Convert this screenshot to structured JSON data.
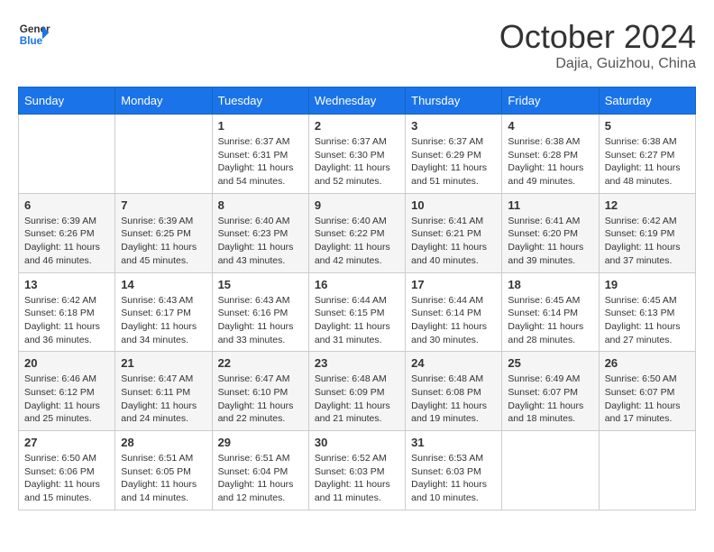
{
  "header": {
    "logo_line1": "General",
    "logo_line2": "Blue",
    "month_title": "October 2024",
    "location": "Dajia, Guizhou, China"
  },
  "weekdays": [
    "Sunday",
    "Monday",
    "Tuesday",
    "Wednesday",
    "Thursday",
    "Friday",
    "Saturday"
  ],
  "weeks": [
    [
      {
        "day": "",
        "sunrise": "",
        "sunset": "",
        "daylight": ""
      },
      {
        "day": "",
        "sunrise": "",
        "sunset": "",
        "daylight": ""
      },
      {
        "day": "1",
        "sunrise": "Sunrise: 6:37 AM",
        "sunset": "Sunset: 6:31 PM",
        "daylight": "Daylight: 11 hours and 54 minutes."
      },
      {
        "day": "2",
        "sunrise": "Sunrise: 6:37 AM",
        "sunset": "Sunset: 6:30 PM",
        "daylight": "Daylight: 11 hours and 52 minutes."
      },
      {
        "day": "3",
        "sunrise": "Sunrise: 6:37 AM",
        "sunset": "Sunset: 6:29 PM",
        "daylight": "Daylight: 11 hours and 51 minutes."
      },
      {
        "day": "4",
        "sunrise": "Sunrise: 6:38 AM",
        "sunset": "Sunset: 6:28 PM",
        "daylight": "Daylight: 11 hours and 49 minutes."
      },
      {
        "day": "5",
        "sunrise": "Sunrise: 6:38 AM",
        "sunset": "Sunset: 6:27 PM",
        "daylight": "Daylight: 11 hours and 48 minutes."
      }
    ],
    [
      {
        "day": "6",
        "sunrise": "Sunrise: 6:39 AM",
        "sunset": "Sunset: 6:26 PM",
        "daylight": "Daylight: 11 hours and 46 minutes."
      },
      {
        "day": "7",
        "sunrise": "Sunrise: 6:39 AM",
        "sunset": "Sunset: 6:25 PM",
        "daylight": "Daylight: 11 hours and 45 minutes."
      },
      {
        "day": "8",
        "sunrise": "Sunrise: 6:40 AM",
        "sunset": "Sunset: 6:23 PM",
        "daylight": "Daylight: 11 hours and 43 minutes."
      },
      {
        "day": "9",
        "sunrise": "Sunrise: 6:40 AM",
        "sunset": "Sunset: 6:22 PM",
        "daylight": "Daylight: 11 hours and 42 minutes."
      },
      {
        "day": "10",
        "sunrise": "Sunrise: 6:41 AM",
        "sunset": "Sunset: 6:21 PM",
        "daylight": "Daylight: 11 hours and 40 minutes."
      },
      {
        "day": "11",
        "sunrise": "Sunrise: 6:41 AM",
        "sunset": "Sunset: 6:20 PM",
        "daylight": "Daylight: 11 hours and 39 minutes."
      },
      {
        "day": "12",
        "sunrise": "Sunrise: 6:42 AM",
        "sunset": "Sunset: 6:19 PM",
        "daylight": "Daylight: 11 hours and 37 minutes."
      }
    ],
    [
      {
        "day": "13",
        "sunrise": "Sunrise: 6:42 AM",
        "sunset": "Sunset: 6:18 PM",
        "daylight": "Daylight: 11 hours and 36 minutes."
      },
      {
        "day": "14",
        "sunrise": "Sunrise: 6:43 AM",
        "sunset": "Sunset: 6:17 PM",
        "daylight": "Daylight: 11 hours and 34 minutes."
      },
      {
        "day": "15",
        "sunrise": "Sunrise: 6:43 AM",
        "sunset": "Sunset: 6:16 PM",
        "daylight": "Daylight: 11 hours and 33 minutes."
      },
      {
        "day": "16",
        "sunrise": "Sunrise: 6:44 AM",
        "sunset": "Sunset: 6:15 PM",
        "daylight": "Daylight: 11 hours and 31 minutes."
      },
      {
        "day": "17",
        "sunrise": "Sunrise: 6:44 AM",
        "sunset": "Sunset: 6:14 PM",
        "daylight": "Daylight: 11 hours and 30 minutes."
      },
      {
        "day": "18",
        "sunrise": "Sunrise: 6:45 AM",
        "sunset": "Sunset: 6:14 PM",
        "daylight": "Daylight: 11 hours and 28 minutes."
      },
      {
        "day": "19",
        "sunrise": "Sunrise: 6:45 AM",
        "sunset": "Sunset: 6:13 PM",
        "daylight": "Daylight: 11 hours and 27 minutes."
      }
    ],
    [
      {
        "day": "20",
        "sunrise": "Sunrise: 6:46 AM",
        "sunset": "Sunset: 6:12 PM",
        "daylight": "Daylight: 11 hours and 25 minutes."
      },
      {
        "day": "21",
        "sunrise": "Sunrise: 6:47 AM",
        "sunset": "Sunset: 6:11 PM",
        "daylight": "Daylight: 11 hours and 24 minutes."
      },
      {
        "day": "22",
        "sunrise": "Sunrise: 6:47 AM",
        "sunset": "Sunset: 6:10 PM",
        "daylight": "Daylight: 11 hours and 22 minutes."
      },
      {
        "day": "23",
        "sunrise": "Sunrise: 6:48 AM",
        "sunset": "Sunset: 6:09 PM",
        "daylight": "Daylight: 11 hours and 21 minutes."
      },
      {
        "day": "24",
        "sunrise": "Sunrise: 6:48 AM",
        "sunset": "Sunset: 6:08 PM",
        "daylight": "Daylight: 11 hours and 19 minutes."
      },
      {
        "day": "25",
        "sunrise": "Sunrise: 6:49 AM",
        "sunset": "Sunset: 6:07 PM",
        "daylight": "Daylight: 11 hours and 18 minutes."
      },
      {
        "day": "26",
        "sunrise": "Sunrise: 6:50 AM",
        "sunset": "Sunset: 6:07 PM",
        "daylight": "Daylight: 11 hours and 17 minutes."
      }
    ],
    [
      {
        "day": "27",
        "sunrise": "Sunrise: 6:50 AM",
        "sunset": "Sunset: 6:06 PM",
        "daylight": "Daylight: 11 hours and 15 minutes."
      },
      {
        "day": "28",
        "sunrise": "Sunrise: 6:51 AM",
        "sunset": "Sunset: 6:05 PM",
        "daylight": "Daylight: 11 hours and 14 minutes."
      },
      {
        "day": "29",
        "sunrise": "Sunrise: 6:51 AM",
        "sunset": "Sunset: 6:04 PM",
        "daylight": "Daylight: 11 hours and 12 minutes."
      },
      {
        "day": "30",
        "sunrise": "Sunrise: 6:52 AM",
        "sunset": "Sunset: 6:03 PM",
        "daylight": "Daylight: 11 hours and 11 minutes."
      },
      {
        "day": "31",
        "sunrise": "Sunrise: 6:53 AM",
        "sunset": "Sunset: 6:03 PM",
        "daylight": "Daylight: 11 hours and 10 minutes."
      },
      {
        "day": "",
        "sunrise": "",
        "sunset": "",
        "daylight": ""
      },
      {
        "day": "",
        "sunrise": "",
        "sunset": "",
        "daylight": ""
      }
    ]
  ]
}
